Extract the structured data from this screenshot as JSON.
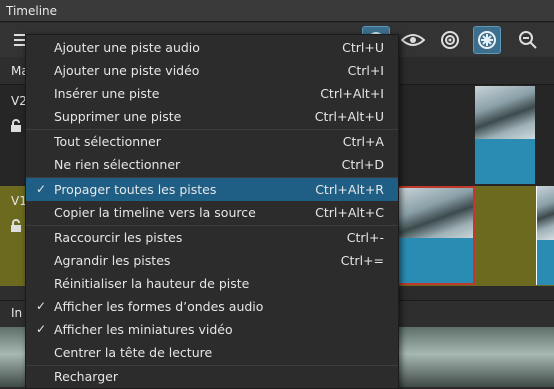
{
  "panel": {
    "title": "Timeline"
  },
  "tracks": [
    {
      "name": "V2"
    },
    {
      "name": "V1"
    }
  ],
  "clipped_labels": {
    "markers": "Ma",
    "footer": "In"
  },
  "menu": {
    "items": [
      {
        "label": "Ajouter une piste audio",
        "shortcut": "Ctrl+U",
        "checked": false
      },
      {
        "label": "Ajouter une piste vidéo",
        "shortcut": "Ctrl+I",
        "checked": false
      },
      {
        "label": "Insérer une piste",
        "shortcut": "Ctrl+Alt+I",
        "checked": false
      },
      {
        "label": "Supprimer une piste",
        "shortcut": "Ctrl+Alt+U",
        "checked": false
      },
      {
        "label": "Tout sélectionner",
        "shortcut": "Ctrl+A",
        "checked": false
      },
      {
        "label": "Ne rien sélectionner",
        "shortcut": "Ctrl+D",
        "checked": false
      },
      {
        "label": "Propager toutes les pistes",
        "shortcut": "Ctrl+Alt+R",
        "checked": true,
        "highlighted": true
      },
      {
        "label": "Copier la timeline vers la source",
        "shortcut": "Ctrl+Alt+C",
        "checked": false
      },
      {
        "label": "Raccourcir les pistes",
        "shortcut": "Ctrl+-",
        "checked": false
      },
      {
        "label": "Agrandir les pistes",
        "shortcut": "Ctrl+=",
        "checked": false
      },
      {
        "label": "Réinitialiser la hauteur de piste",
        "shortcut": "",
        "checked": false
      },
      {
        "label": "Afficher les formes d’ondes audio",
        "shortcut": "",
        "checked": true
      },
      {
        "label": "Afficher les miniatures vidéo",
        "shortcut": "",
        "checked": true
      },
      {
        "label": "Centrer la tête de lecture",
        "shortcut": "",
        "checked": false
      },
      {
        "label": "Recharger",
        "shortcut": "",
        "checked": false
      }
    ],
    "check_glyph": "✓"
  },
  "colors": {
    "highlight": "#1f5f86",
    "track_v1": "#6b6a1f",
    "waveform": "#2a8bb3",
    "selected_clip_border": "#c0392b"
  },
  "icons": [
    "menu-icon",
    "eye-icon",
    "target-icon",
    "snap-icon",
    "zoom-out-icon",
    "lock-icon"
  ]
}
